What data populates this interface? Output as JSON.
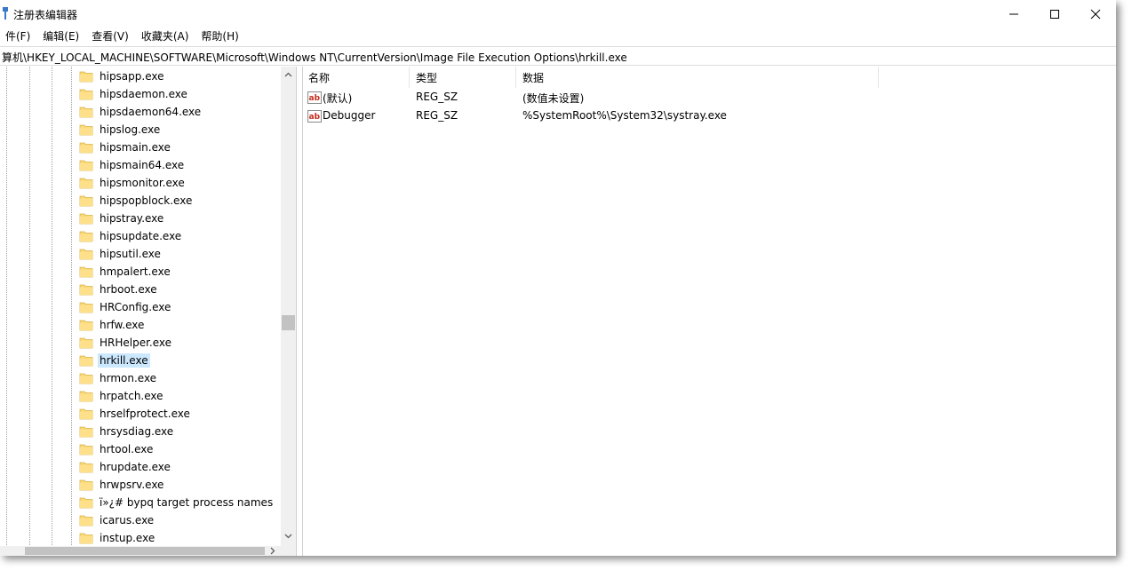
{
  "window": {
    "title": "注册表编辑器"
  },
  "menu": {
    "items": [
      "件(F)",
      "编辑(E)",
      "查看(V)",
      "收藏夹(A)",
      "帮助(H)"
    ]
  },
  "address": {
    "path": "算机\\HKEY_LOCAL_MACHINE\\SOFTWARE\\Microsoft\\Windows NT\\CurrentVersion\\Image File Execution Options\\hrkill.exe"
  },
  "tree": {
    "items": [
      {
        "label": "hipsapp.exe"
      },
      {
        "label": "hipsdaemon.exe"
      },
      {
        "label": "hipsdaemon64.exe"
      },
      {
        "label": "hipslog.exe"
      },
      {
        "label": "hipsmain.exe"
      },
      {
        "label": "hipsmain64.exe"
      },
      {
        "label": "hipsmonitor.exe"
      },
      {
        "label": "hipspopblock.exe"
      },
      {
        "label": "hipstray.exe"
      },
      {
        "label": "hipsupdate.exe"
      },
      {
        "label": "hipsutil.exe"
      },
      {
        "label": "hmpalert.exe"
      },
      {
        "label": "hrboot.exe"
      },
      {
        "label": "HRConfig.exe"
      },
      {
        "label": "hrfw.exe"
      },
      {
        "label": "HRHelper.exe"
      },
      {
        "label": "hrkill.exe",
        "selected": true
      },
      {
        "label": "hrmon.exe"
      },
      {
        "label": "hrpatch.exe"
      },
      {
        "label": "hrselfprotect.exe"
      },
      {
        "label": "hrsysdiag.exe"
      },
      {
        "label": "hrtool.exe"
      },
      {
        "label": "hrupdate.exe"
      },
      {
        "label": "hrwpsrv.exe"
      },
      {
        "label": "ï»¿# bypq target process names"
      },
      {
        "label": "icarus.exe"
      },
      {
        "label": "instup.exe"
      }
    ]
  },
  "values": {
    "headers": {
      "name": "名称",
      "type": "类型",
      "data": "数据"
    },
    "rows": [
      {
        "name": "(默认)",
        "type": "REG_SZ",
        "data": "(数值未设置)"
      },
      {
        "name": "Debugger",
        "type": "REG_SZ",
        "data": "%SystemRoot%\\System32\\systray.exe"
      }
    ]
  },
  "colors": {
    "selection": "#cce8ff",
    "folder": "#f8d775",
    "reg_icon_red": "#c42b1c"
  },
  "icons": {
    "app": "registry-editor-icon",
    "folder": "folder-icon",
    "value": "reg-sz-icon"
  }
}
